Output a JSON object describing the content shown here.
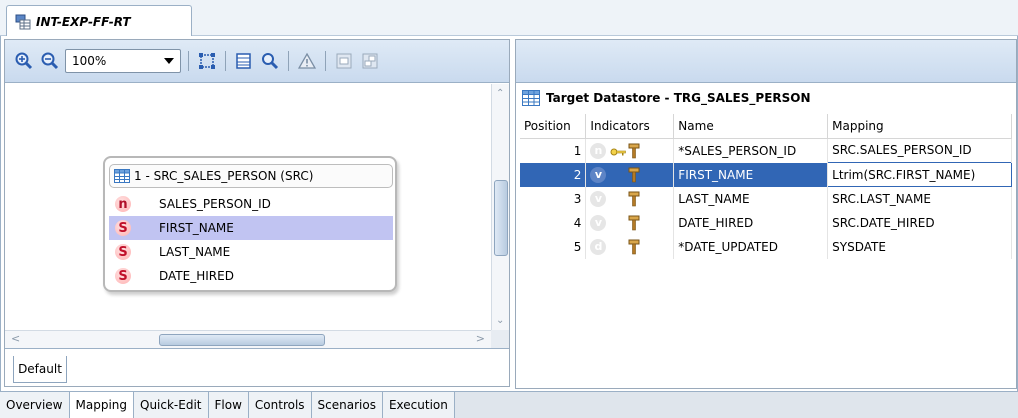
{
  "editor_tab": {
    "title": "INT-EXP-FF-RT",
    "icon": "interface-icon"
  },
  "toolbar": {
    "zoom_value": "100%",
    "buttons": [
      "zoom-in-icon",
      "zoom-out-icon",
      "fit-icon",
      "properties-icon",
      "search-icon",
      "warning-icon",
      "layout-icon",
      "arrange-icon"
    ]
  },
  "source_datastore": {
    "title": "1 - SRC_SALES_PERSON (SRC)",
    "columns": [
      {
        "type": "n",
        "name": "SALES_PERSON_ID",
        "selected": false
      },
      {
        "type": "S",
        "name": "FIRST_NAME",
        "selected": true
      },
      {
        "type": "S",
        "name": "LAST_NAME",
        "selected": false
      },
      {
        "type": "S",
        "name": "DATE_HIRED",
        "selected": false
      }
    ]
  },
  "left_bottom_tab": "Default",
  "target": {
    "title": "Target Datastore - TRG_SALES_PERSON",
    "headers": {
      "position": "Position",
      "indicators": "Indicators",
      "name": "Name",
      "mapping": "Mapping"
    },
    "rows": [
      {
        "position": "1",
        "type": "n",
        "key": true,
        "name": "*SALES_PERSON_ID",
        "mapping": "SRC.SALES_PERSON_ID",
        "selected": false
      },
      {
        "position": "2",
        "type": "v",
        "key": false,
        "name": "FIRST_NAME",
        "mapping": "Ltrim(SRC.FIRST_NAME)",
        "selected": true
      },
      {
        "position": "3",
        "type": "v",
        "key": false,
        "name": "LAST_NAME",
        "mapping": "SRC.LAST_NAME",
        "selected": false
      },
      {
        "position": "4",
        "type": "v",
        "key": false,
        "name": "DATE_HIRED",
        "mapping": "SRC.DATE_HIRED",
        "selected": false
      },
      {
        "position": "5",
        "type": "d",
        "key": false,
        "name": "*DATE_UPDATED",
        "mapping": "SYSDATE",
        "selected": false
      }
    ]
  },
  "bottom_tabs": [
    {
      "label": "Overview",
      "active": false
    },
    {
      "label": "Mapping",
      "active": true
    },
    {
      "label": "Quick-Edit",
      "active": false
    },
    {
      "label": "Flow",
      "active": false
    },
    {
      "label": "Controls",
      "active": false
    },
    {
      "label": "Scenarios",
      "active": false
    },
    {
      "label": "Execution",
      "active": false
    }
  ],
  "colors": {
    "selection": "#3166b5",
    "diagram_selection": "#c1c4f2",
    "toolbar": "#c9daee",
    "datatype_red": "#c0102a"
  }
}
